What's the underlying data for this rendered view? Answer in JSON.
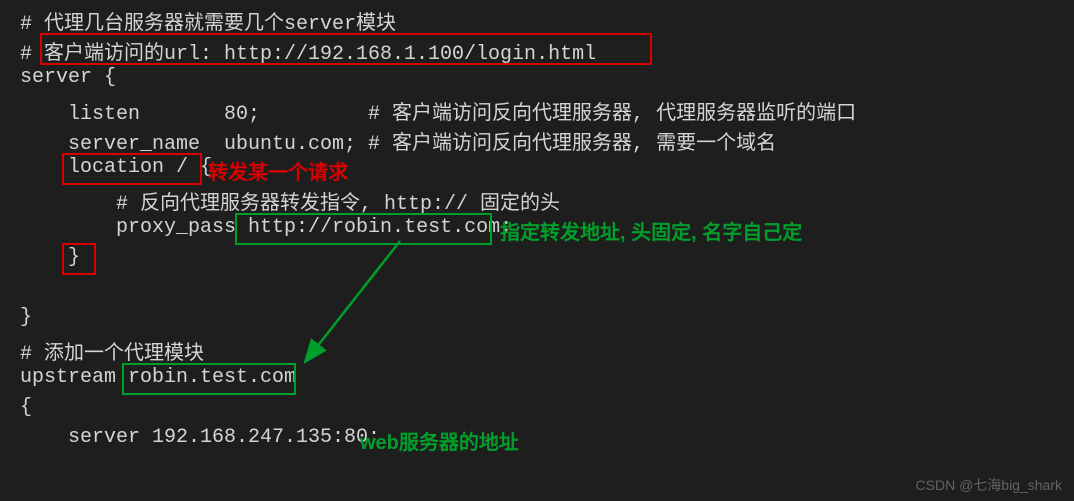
{
  "code": {
    "l1": "# 代理几台服务器就需要几个server模块",
    "l2": "# 客户端访问的url: http://192.168.1.100/login.html",
    "l3a": "server {",
    "l4a": "    listen       80;         # 客户端访问反向代理服务器, 代理服务器监听的端口",
    "l5a": "    server_name  ubuntu.com; # 客户端访问反向代理服务器, 需要一个域名",
    "l6a": "    location / {",
    "l7a": "        # 反向代理服务器转发指令, http:// 固定的头",
    "l8a": "        proxy_pass http://robin.test.com;",
    "l9a": "    }",
    "l10": "",
    "l11": "}",
    "l12": "# 添加一个代理模块",
    "l13": "upstream robin.test.com",
    "l14": "{",
    "l15": "    server 192.168.247.135:80;"
  },
  "annotations": {
    "forward_request": "转发某一个请求",
    "specify_forward_addr": "指定转发地址, 头固定, 名字自己定",
    "web_server_addr": "web服务器的地址"
  },
  "watermark": "CSDN @七海big_shark"
}
